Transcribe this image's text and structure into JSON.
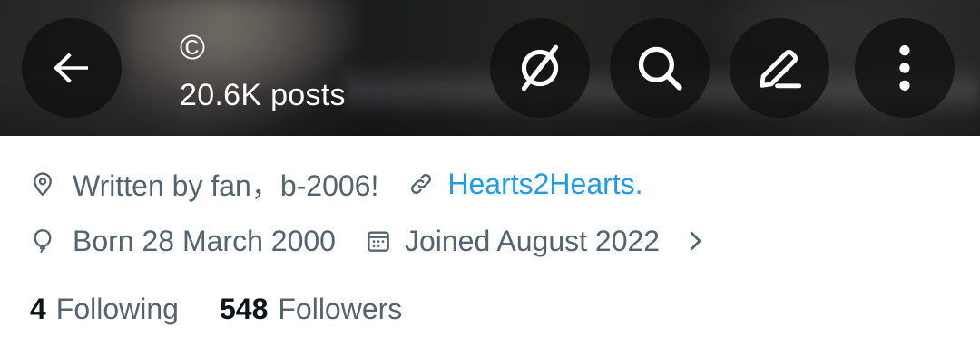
{
  "header": {
    "title": "©",
    "post_count": "20.6K posts",
    "buttons": [
      {
        "icon": "back-arrow-icon"
      },
      {
        "icon": "grok-icon"
      },
      {
        "icon": "search-icon"
      },
      {
        "icon": "edit-icon"
      },
      {
        "icon": "more-vertical-icon"
      }
    ]
  },
  "profile": {
    "location": "Written by fan，b-2006!",
    "website": "Hearts2Hearts.",
    "birthday": "Born 28 March 2000",
    "joined": "Joined August 2022",
    "following_count": "4",
    "following_label": "Following",
    "followers_count": "548",
    "followers_label": "Followers"
  },
  "colors": {
    "muted_text": "#536471",
    "link": "#1d9bf0",
    "strong_text": "#0f1419",
    "button_bg": "rgba(15,15,15,0.78)"
  }
}
